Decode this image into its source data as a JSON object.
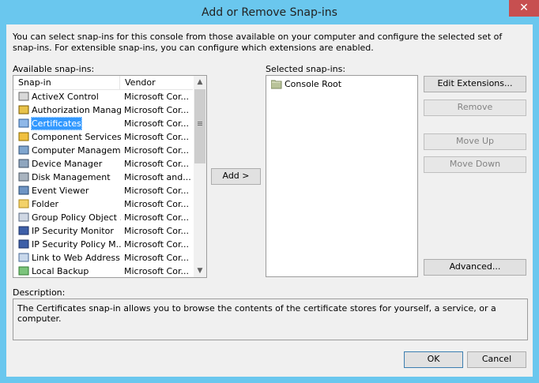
{
  "window": {
    "title": "Add or Remove Snap-ins",
    "close_glyph": "✕"
  },
  "intro_text": "You can select snap-ins for this console from those available on your computer and configure the selected set of snap-ins. For extensible snap-ins, you can configure which extensions are enabled.",
  "available": {
    "label": "Available snap-ins:",
    "columns": [
      "Snap-in",
      "Vendor"
    ],
    "selected_index": 2,
    "items": [
      {
        "name": "ActiveX Control",
        "vendor": "Microsoft Cor...",
        "icon": "activex-icon"
      },
      {
        "name": "Authorization Manager",
        "vendor": "Microsoft Cor...",
        "icon": "authorization-icon"
      },
      {
        "name": "Certificates",
        "vendor": "Microsoft Cor...",
        "icon": "certificates-icon"
      },
      {
        "name": "Component Services",
        "vendor": "Microsoft Cor...",
        "icon": "component-services-icon"
      },
      {
        "name": "Computer Managem...",
        "vendor": "Microsoft Cor...",
        "icon": "computer-management-icon"
      },
      {
        "name": "Device Manager",
        "vendor": "Microsoft Cor...",
        "icon": "device-manager-icon"
      },
      {
        "name": "Disk Management",
        "vendor": "Microsoft and...",
        "icon": "disk-management-icon"
      },
      {
        "name": "Event Viewer",
        "vendor": "Microsoft Cor...",
        "icon": "event-viewer-icon"
      },
      {
        "name": "Folder",
        "vendor": "Microsoft Cor...",
        "icon": "folder-icon"
      },
      {
        "name": "Group Policy Object ...",
        "vendor": "Microsoft Cor...",
        "icon": "group-policy-icon"
      },
      {
        "name": "IP Security Monitor",
        "vendor": "Microsoft Cor...",
        "icon": "ip-security-monitor-icon"
      },
      {
        "name": "IP Security Policy M...",
        "vendor": "Microsoft Cor...",
        "icon": "ip-security-policy-icon"
      },
      {
        "name": "Link to Web Address",
        "vendor": "Microsoft Cor...",
        "icon": "web-link-icon"
      },
      {
        "name": "Local Backup",
        "vendor": "Microsoft Cor...",
        "icon": "local-backup-icon"
      }
    ]
  },
  "add_button": "Add >",
  "selected": {
    "label": "Selected snap-ins:",
    "items": [
      {
        "name": "Console Root",
        "icon": "folder-icon"
      }
    ]
  },
  "side_buttons": {
    "edit_extensions": "Edit Extensions...",
    "remove": "Remove",
    "move_up": "Move Up",
    "move_down": "Move Down",
    "advanced": "Advanced..."
  },
  "description": {
    "label": "Description:",
    "text": "The Certificates snap-in allows you to browse the contents of the certificate stores for yourself, a service, or a computer."
  },
  "footer": {
    "ok": "OK",
    "cancel": "Cancel"
  },
  "colors": {
    "title_bar": "#6ac7ee",
    "close_button": "#c74f50",
    "selection": "#3399ff"
  }
}
